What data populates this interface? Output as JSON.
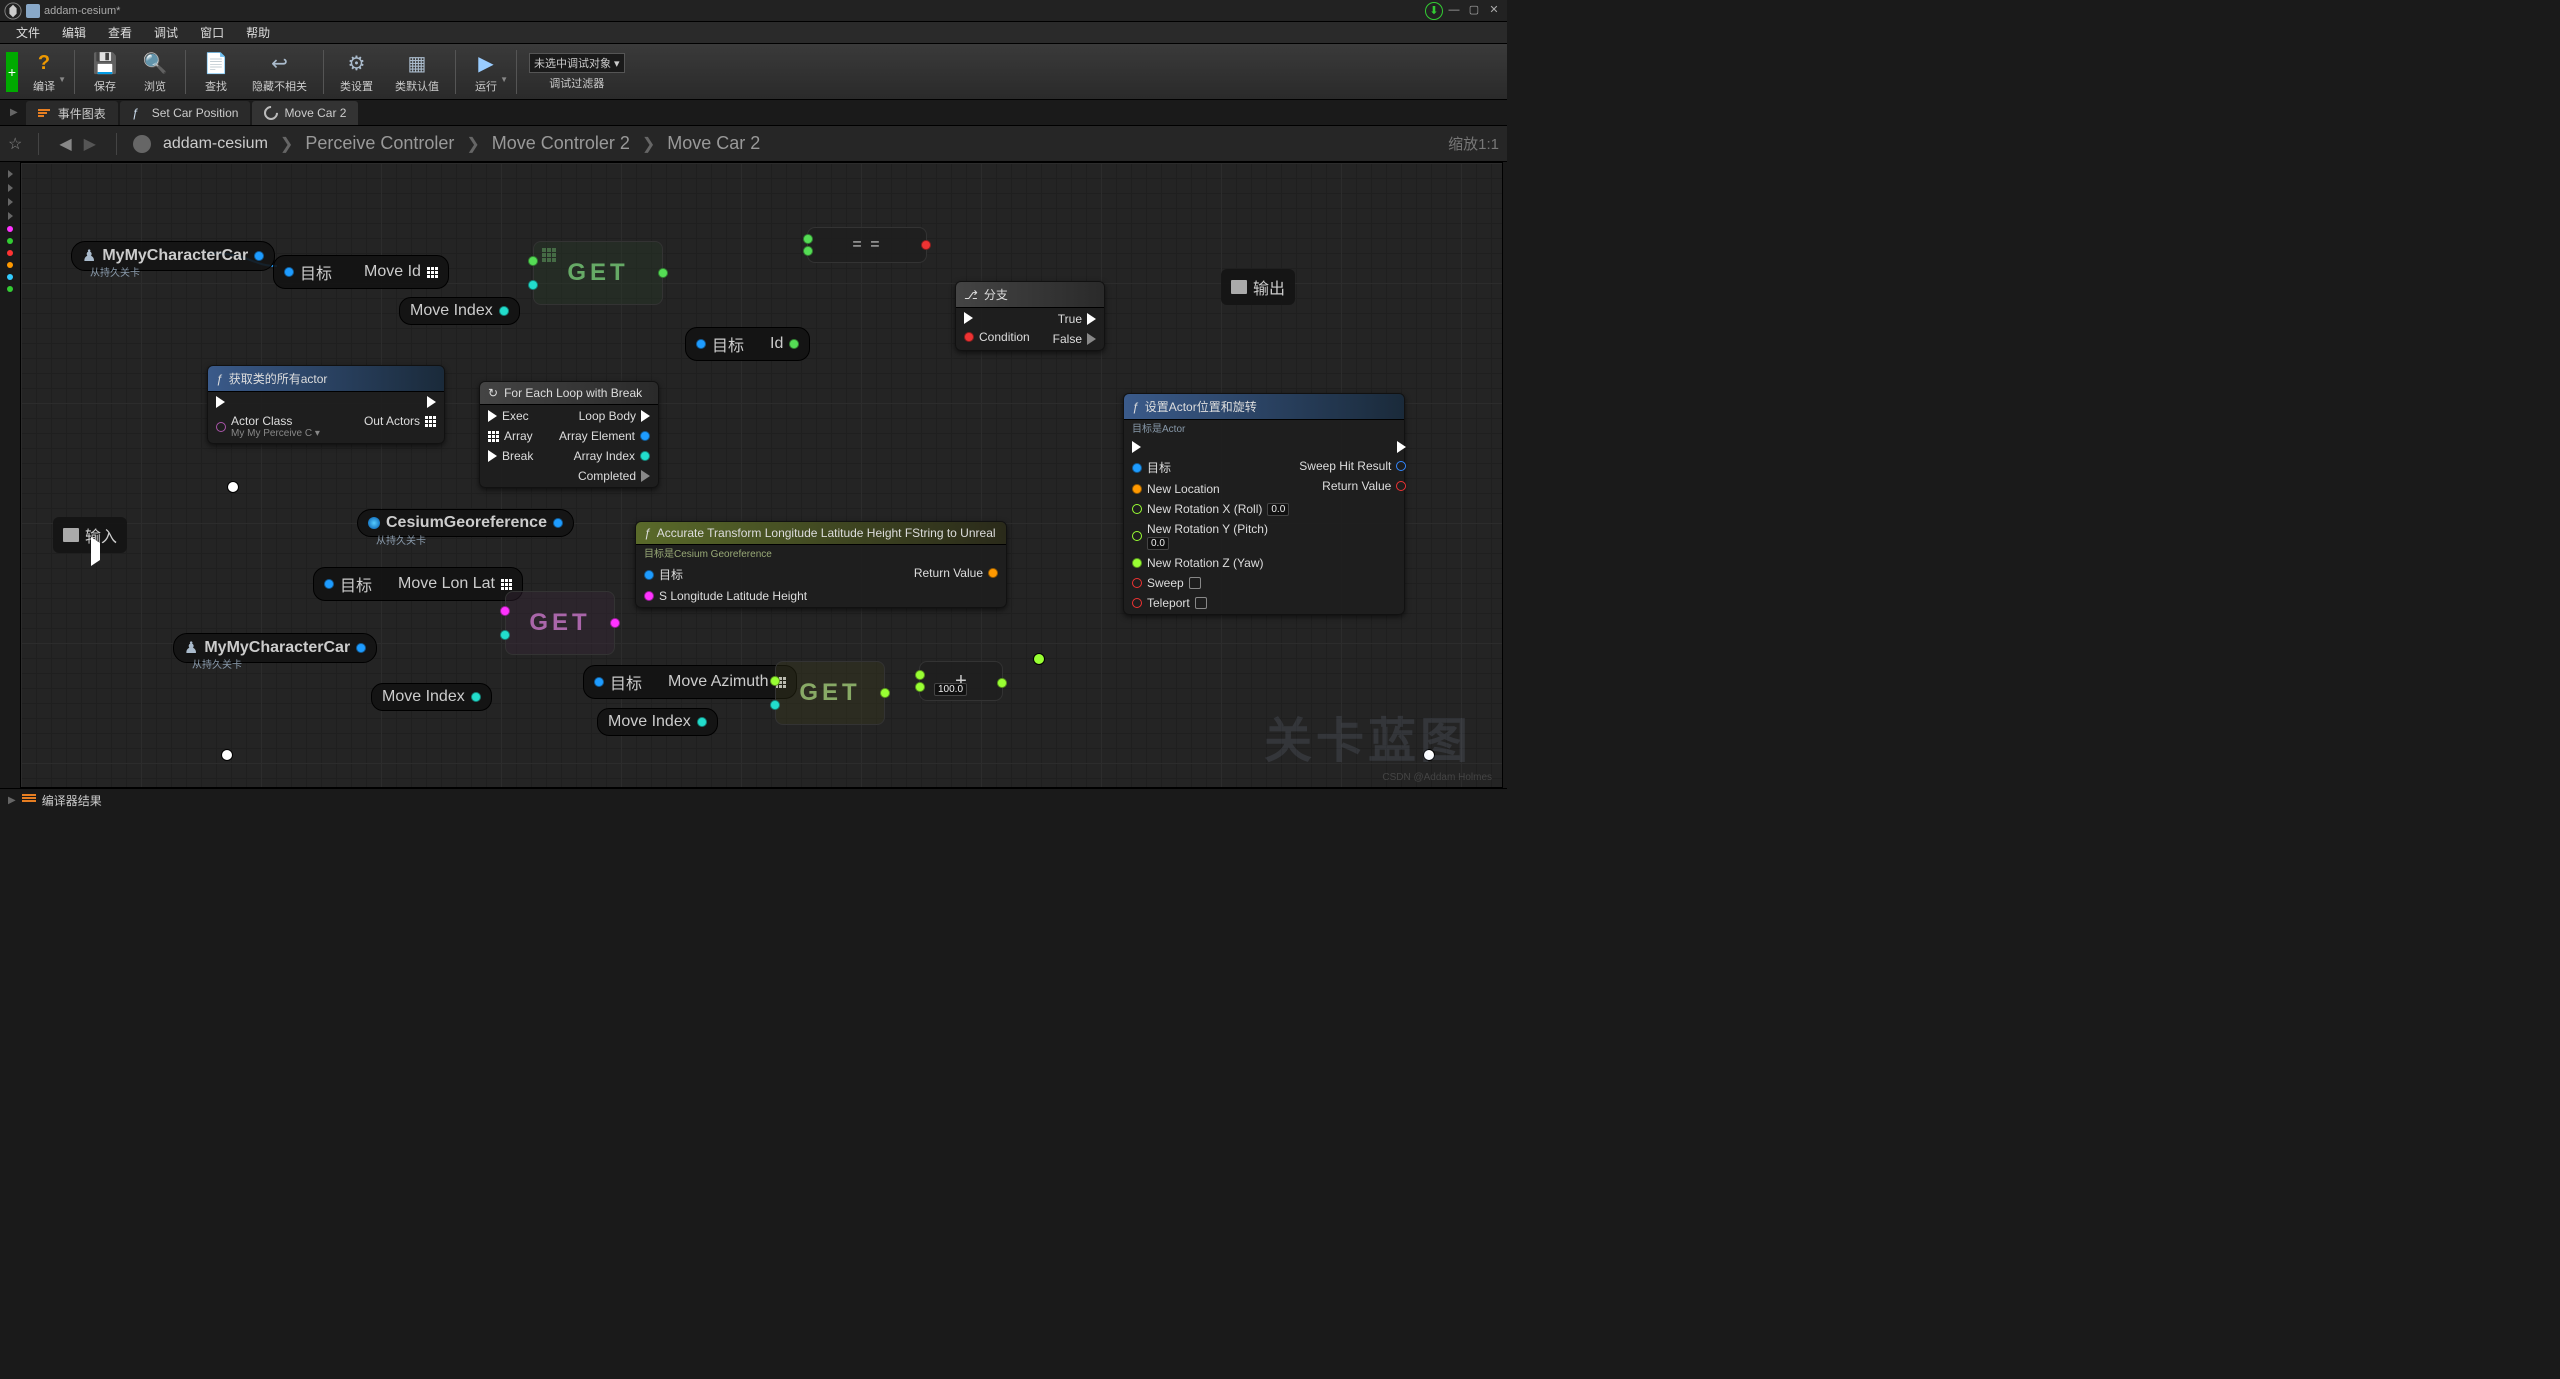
{
  "title": "addam-cesium*",
  "menus": [
    "文件",
    "编辑",
    "查看",
    "调试",
    "窗口",
    "帮助"
  ],
  "toolbar": {
    "compile": "编译",
    "save": "保存",
    "browse": "浏览",
    "find": "查找",
    "hide": "隐藏不相关",
    "class": "类设置",
    "defaults": "类默认值",
    "run": "运行",
    "no_debug": "未选中调试对象",
    "debug_filter": "调试过滤器"
  },
  "tabs": {
    "events": "事件图表",
    "setcar": "Set Car Position",
    "movecar": "Move Car 2"
  },
  "breadcrumb": {
    "root": "addam-cesium",
    "c1": "Perceive Controler",
    "c2": "Move Controler 2",
    "c3": "Move Car 2",
    "zoom": "缩放1:1"
  },
  "nodes": {
    "char1": {
      "title": "MyMyCharacterCar",
      "sub": "从持久关卡"
    },
    "char2": {
      "title": "MyMyCharacterCar",
      "sub": "从持久关卡"
    },
    "cesium": {
      "title": "CesiumGeoreference",
      "sub": "从持久关卡"
    },
    "target": "目标",
    "moveid": "Move Id",
    "moveindex": "Move Index",
    "movelonlat": "Move Lon Lat",
    "moveazimuth": "Move Azimuth",
    "id": "Id",
    "get": "GET",
    "getactors": {
      "title": "获取类的所有actor",
      "cls_l": "Actor Class",
      "cls_v": "My My Perceive C",
      "out": "Out Actors"
    },
    "foreach": {
      "title": "For Each Loop with Break",
      "exec": "Exec",
      "array": "Array",
      "break": "Break",
      "loopbody": "Loop Body",
      "elem": "Array Element",
      "index": "Array Index",
      "completed": "Completed"
    },
    "branch": {
      "title": "分支",
      "cond": "Condition",
      "true": "True",
      "false": "False"
    },
    "eq": "= =",
    "transform": {
      "title": "Accurate Transform Longitude Latitude Height FString to Unreal",
      "sub": "目标是Cesium Georeference",
      "target": "目标",
      "s": "S Longitude Latitude Height",
      "ret": "Return Value"
    },
    "setactor": {
      "title": "设置Actor位置和旋转",
      "sub": "目标是Actor",
      "target": "目标",
      "newloc": "New Location",
      "rotx": "New Rotation X (Roll)",
      "roty": "New Rotation Y (Pitch)",
      "rotz": "New Rotation Z (Yaw)",
      "sweep": "Sweep",
      "teleport": "Teleport",
      "sweephit": "Sweep Hit Result",
      "retval": "Return Value",
      "zero": "0.0"
    },
    "add": {
      "val": "100.0"
    },
    "input": "输入",
    "output": "输出"
  },
  "footer": "编译器结果",
  "watermark": "关卡蓝图",
  "csdn": "CSDN @Addam Holmes"
}
